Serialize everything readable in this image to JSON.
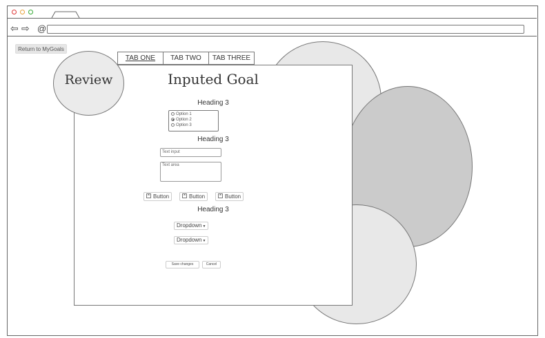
{
  "browser": {
    "dots": [
      "#d33",
      "#e8a23a",
      "#3a3"
    ],
    "back_icon": "arrow-left-outline",
    "forward_icon": "arrow-right-outline",
    "reload_icon": "at-refresh",
    "back_glyph": "⇦",
    "forward_glyph": "⇨",
    "reload_glyph": "@",
    "url_value": ""
  },
  "return_button": "Return to MyGoals",
  "review_label": "Review",
  "tabs": [
    {
      "label": "TAB ONE",
      "active": true
    },
    {
      "label": "TAB TWO",
      "active": false
    },
    {
      "label": "TAB THREE",
      "active": false
    }
  ],
  "page_title": "Inputed Goal",
  "section1": {
    "heading": "Heading 3",
    "options": [
      {
        "label": "Option 1",
        "selected": false
      },
      {
        "label": "Option 2",
        "selected": true
      },
      {
        "label": "Option 3",
        "selected": false
      }
    ]
  },
  "section2": {
    "heading": "Heading 3",
    "text_input": "Text input",
    "text_area": "Text area"
  },
  "buttons": [
    "Button",
    "Button",
    "Button"
  ],
  "section3": {
    "heading": "Heading 3",
    "dropdowns": [
      "Dropdown",
      "Dropdown"
    ]
  },
  "actions": {
    "save": "Save changes",
    "cancel": "Cancel"
  },
  "colors": {
    "circle_light": "#e8e8e8",
    "circle_dark": "#cbcbcb",
    "circle_review": "#ebebeb"
  }
}
